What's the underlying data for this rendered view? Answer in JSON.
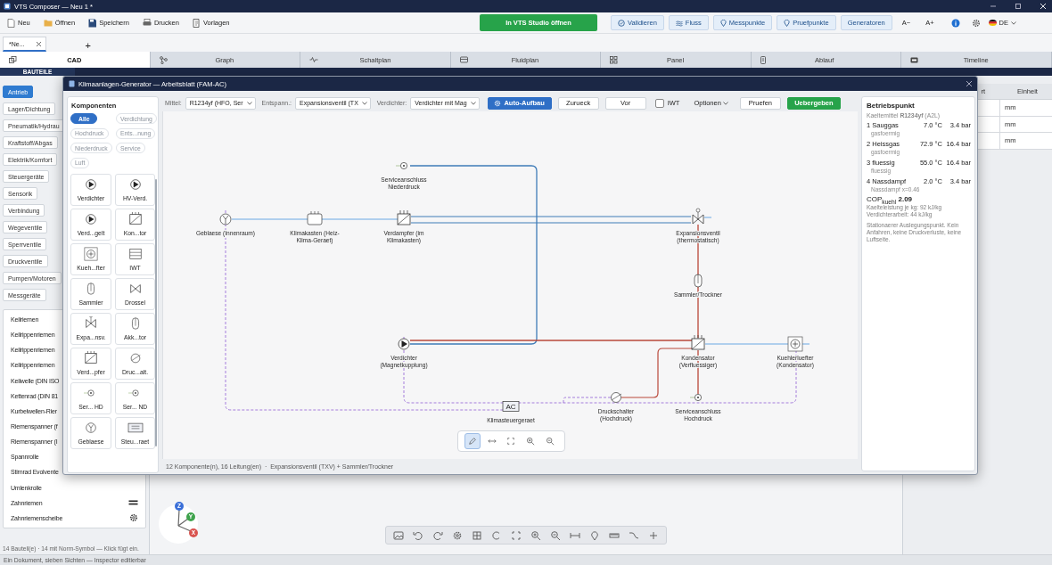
{
  "window": {
    "title": "VTS Composer — Neu 1 *"
  },
  "toolbar": {
    "left": [
      "Neu",
      "Öffnen",
      "Speichern",
      "Drucken",
      "Vorlagen"
    ],
    "primary": "In VTS Studio öffnen",
    "right": [
      "Validieren",
      "Fluss",
      "Messpunkte",
      "Pruefpunkte",
      "Generatoren"
    ],
    "font_smaller": "A−",
    "font_larger": "A+",
    "language": "DE"
  },
  "document_tabs": [
    {
      "label": "*Ne...",
      "selected": true
    }
  ],
  "new_tab": "+",
  "view_tabs": [
    {
      "label": "CAD",
      "selected": true
    },
    {
      "label": "Graph",
      "selected": false
    },
    {
      "label": "Schaltplan",
      "selected": false
    },
    {
      "label": "Fluidplan",
      "selected": false
    },
    {
      "label": "Panel",
      "selected": false
    },
    {
      "label": "Ablauf",
      "selected": false
    },
    {
      "label": "Timeline",
      "selected": false
    }
  ],
  "sidebar": {
    "tabs": [
      {
        "label": "BAUTEILE",
        "selected": true
      }
    ],
    "categories": [
      {
        "label": "Antrieb",
        "selected": true
      },
      {
        "label": "Lager/Dichtung",
        "selected": false
      },
      {
        "label": "Pneumatik/Hydrau",
        "selected": false
      },
      {
        "label": "Kraftstoff/Abgas",
        "selected": false
      },
      {
        "label": "Elektrik/Komfort",
        "selected": false
      },
      {
        "label": "Steuergeräte",
        "selected": false
      },
      {
        "label": "Sensorik",
        "selected": false
      },
      {
        "label": "Verbindung",
        "selected": false
      },
      {
        "label": "Wegeventile",
        "selected": false
      },
      {
        "label": "Sperrventile",
        "selected": false
      },
      {
        "label": "Druckventile",
        "selected": false
      },
      {
        "label": "Pumpen/Motoren",
        "selected": false
      },
      {
        "label": "Messgeräte",
        "selected": false
      }
    ],
    "items": [
      "Keilriemen",
      "Keilrippenriemen",
      "Keilrippenriemen",
      "Keilrippenriemen",
      "Keilwelle (DIN ISO",
      "Kettenrad (DIN 81",
      "Kurbelwellen-Rier",
      "Riemenspanner (f",
      "Riemenspanner (I",
      "Spannrolle",
      "Stirnrad Evolvente",
      "Umlenkrolle",
      "Zahnriemen",
      "Zahnriemenscheibe"
    ],
    "status": "14 Bauteil(e) · 14 mit Norm-Symbol — Klick fügt ein."
  },
  "inspector": {
    "columns": [
      "rt",
      "Einheit"
    ],
    "rows": [
      {
        "unit": "mm"
      },
      {
        "unit": "mm"
      },
      {
        "unit": "mm"
      }
    ]
  },
  "axis_gizmo": {
    "labels": [
      "Z",
      "Y",
      "X"
    ]
  },
  "dialog": {
    "title": "Klimaanlagen-Generator — Arbeitsblatt (FAM-AC)",
    "palette": {
      "title": "Komponenten",
      "filters": [
        {
          "label": "Alle",
          "selected": true
        },
        {
          "label": "Verdichtung",
          "selected": false
        },
        {
          "label": "Hochdruck",
          "selected": false
        },
        {
          "label": "Ents...nung",
          "selected": false
        },
        {
          "label": "Niederdruck",
          "selected": false
        },
        {
          "label": "Service",
          "selected": false
        },
        {
          "label": "Luft",
          "selected": false
        }
      ],
      "tiles": [
        {
          "label": "Verdichter"
        },
        {
          "label": "HV-Verd."
        },
        {
          "label": "Verd...gelt"
        },
        {
          "label": "Kon...tor"
        },
        {
          "label": "Kueh...fter"
        },
        {
          "label": "IWT"
        },
        {
          "label": "Sammler"
        },
        {
          "label": "Drossel"
        },
        {
          "label": "Expa...nsv."
        },
        {
          "label": "Akk...tor"
        },
        {
          "label": "Verd...pfer"
        },
        {
          "label": "Druc...alt."
        },
        {
          "label": "Ser... HD"
        },
        {
          "label": "Ser... ND"
        },
        {
          "label": "Geblaese"
        },
        {
          "label": "Steu...raet"
        }
      ]
    },
    "controls": [
      {
        "kind": "select",
        "label": "Mittel:",
        "value": "R1234yf (HFO, Ser"
      },
      {
        "kind": "select",
        "label": "Entspann.:",
        "value": "Expansionsventil (TX"
      },
      {
        "kind": "select",
        "label": "Verdichter:",
        "value": "Verdichter mit Mag"
      },
      {
        "kind": "primary_button",
        "label": "Auto-Aufbau"
      },
      {
        "kind": "button",
        "label": "Zurueck"
      },
      {
        "kind": "button",
        "label": "Vor"
      },
      {
        "kind": "checkbox",
        "label": "IWT",
        "checked": false
      },
      {
        "kind": "menu",
        "label": "Optionen"
      },
      {
        "kind": "button",
        "label": "Pruefen"
      },
      {
        "kind": "confirm_button",
        "label": "Uebergeben"
      }
    ],
    "diagram": {
      "nodes": [
        {
          "kind": "service_port",
          "lines": [
            "Serviceanschluss",
            "Niederdruck"
          ]
        },
        {
          "kind": "fan",
          "lines": [
            "Geblaese (Innenraum)"
          ]
        },
        {
          "kind": "box",
          "lines": [
            "Klimakasten (Heiz-",
            "Klima-Geraet)"
          ]
        },
        {
          "kind": "heat_exchanger",
          "lines": [
            "Verdampfer (im",
            "Klimakasten)"
          ]
        },
        {
          "kind": "expansion_valve",
          "lines": [
            "Expansionsventil",
            "(thermostatisch)"
          ]
        },
        {
          "kind": "receiver",
          "lines": [
            "Sammler/Trockner"
          ]
        },
        {
          "kind": "compressor",
          "lines": [
            "Verdichter",
            "(Magnetkupplung)"
          ]
        },
        {
          "kind": "heat_exchanger",
          "lines": [
            "Kondensator",
            "(Verfluessiger)"
          ]
        },
        {
          "kind": "radiator_fan",
          "lines": [
            "Kuehlerluefter",
            "(Kondensator)"
          ]
        },
        {
          "kind": "controller",
          "symbol_text": "AC",
          "lines": [
            "Klimasteuergeraet"
          ]
        },
        {
          "kind": "pressure_switch",
          "lines": [
            "Druckschalter",
            "(Hochdruck)"
          ]
        },
        {
          "kind": "service_port",
          "lines": [
            "Serviceanschluss",
            "Hochdruck"
          ]
        }
      ]
    },
    "diagram_tools": [
      {
        "selected": true
      },
      {
        "selected": false
      },
      {
        "selected": false
      },
      {
        "selected": false
      },
      {
        "selected": false
      }
    ],
    "summary": "12 Komponente(n), 16 Leitung(en)  ·  Expansionsventil (TXV) + Sammler/Trockner",
    "operating_point": {
      "title": "Betriebspunkt",
      "refrigerant": "Kaeltemittel **R1234yf** (A2L)",
      "states": [
        {
          "name": "1 Sauggas",
          "temperature": "7.0 °C",
          "pressure": "3.4 bar",
          "phase": "gasfoermig"
        },
        {
          "name": "2 Heissgas",
          "temperature": "72.9 °C",
          "pressure": "16.4 bar",
          "phase": "gasfoermig"
        },
        {
          "name": "3 fluessig",
          "temperature": "55.0 °C",
          "pressure": "16.4 bar",
          "phase": "fluessig"
        },
        {
          "name": "4 Nassdampf",
          "temperature": "2.0 °C",
          "pressure": "3.4 bar",
          "phase": "Nassdampf x=0.46"
        }
      ],
      "cop": "COP$_{kuehl}$ **2.09**",
      "cooling_capacity": "Kaelteleistung je kg: 92 kJ/kg",
      "compressor_work": "Verdichterarbeit: 44 kJ/kg",
      "note": "Stationaerer Auslegungspunkt. Kein Anfahren, keine Druckverluste, keine Luftseite."
    }
  },
  "status_bar": "Ein Dokument, sieben Sichten — Inspector editierbar"
}
